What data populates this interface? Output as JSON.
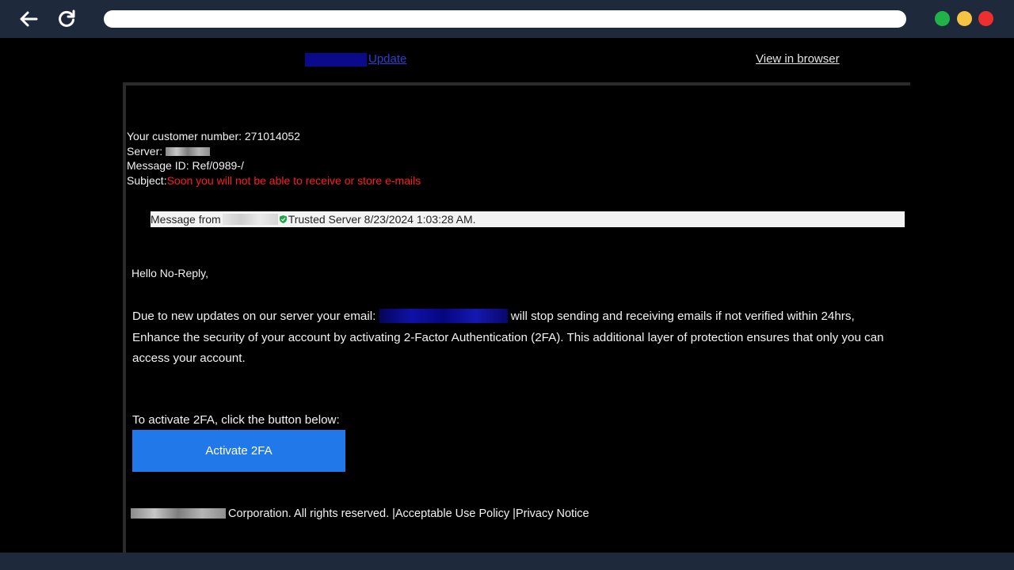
{
  "top_links": {
    "update": "Update",
    "view_in_browser": "View in browser"
  },
  "meta": {
    "customer_number_label": "Your customer number: 271014052",
    "server_label": "Server:",
    "message_id": "Message ID: Ref/0989-/",
    "subject_label": "Subject:",
    "subject_value": "Soon you will not be able to receive or store e-mails"
  },
  "trust_bar": {
    "prefix": "Message from",
    "suffix": "Trusted Server 8/23/2024 1:03:28 AM."
  },
  "greeting": "Hello No-Reply,",
  "body": {
    "part1": "Due to new updates on our server your email:",
    "part2": "will stop sending and receiving emails if not verified within 24hrs, Enhance the security of your account by activating 2-Factor Authentication (2FA). This additional layer of protection ensures that only you can access your account."
  },
  "cta": {
    "instruction": "To activate 2FA, click the button below:",
    "button_label": "Activate 2FA"
  },
  "footer": {
    "rights": "Corporation. All rights reserved.",
    "sep1": " |",
    "aup": "Acceptable Use Policy",
    "sep2": " |",
    "privacy": "Privacy Notice"
  },
  "colors": {
    "chrome": "#1e2a3b",
    "button": "#2178e8",
    "subject": "#ff1d1d",
    "dot_green": "#1fb34a",
    "dot_yellow": "#f6c343",
    "dot_red": "#ee2f2f"
  }
}
